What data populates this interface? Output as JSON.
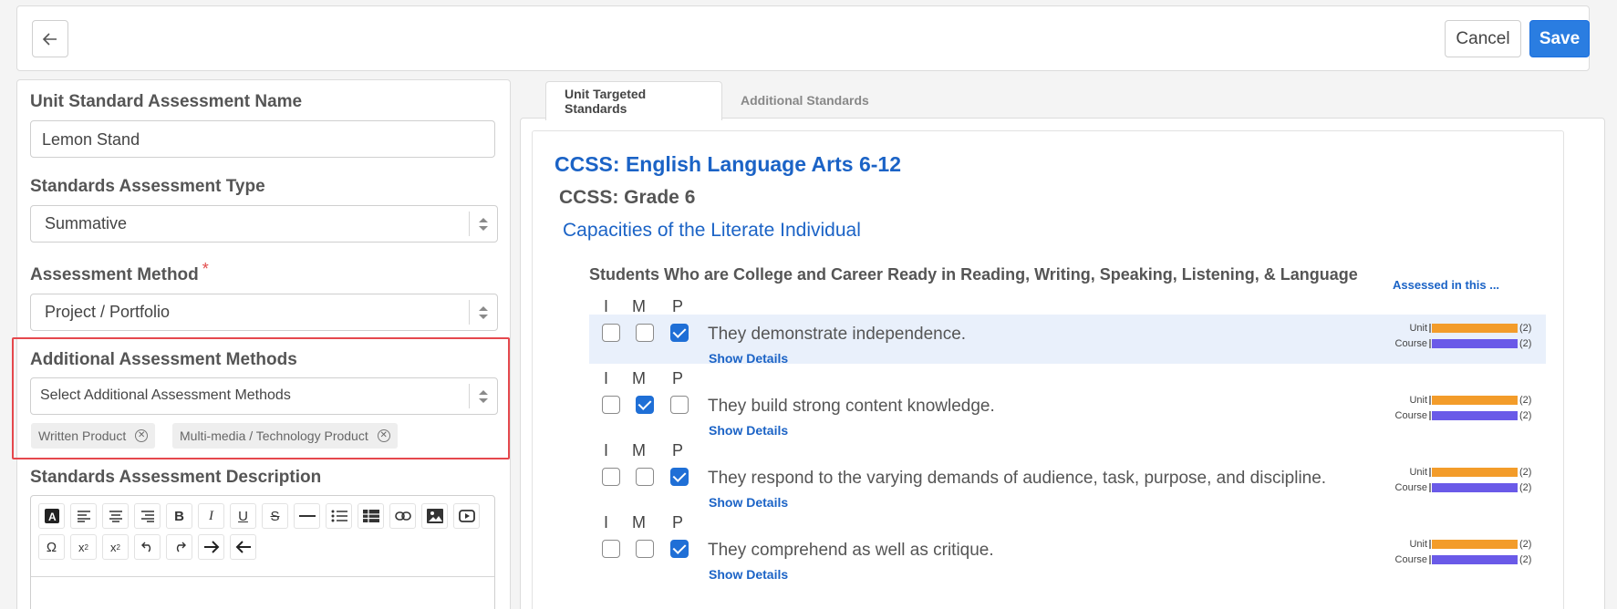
{
  "topbar": {
    "cancel_label": "Cancel",
    "save_label": "Save"
  },
  "form": {
    "name_label": "Unit Standard Assessment Name",
    "name_value": "Lemon Stand",
    "type_label": "Standards Assessment Type",
    "type_value": "Summative",
    "method_label": "Assessment Method",
    "method_required": "*",
    "method_value": "Project / Portfolio",
    "additional_label": "Additional Assessment Methods",
    "additional_placeholder": "Select Additional Assessment Methods",
    "chips": [
      "Written Product",
      "Multi-media / Technology Product"
    ],
    "description_label": "Standards Assessment Description",
    "toolbar_row1": [
      "text-color-icon",
      "align-left-icon",
      "align-center-icon",
      "align-right-icon",
      "bold-icon",
      "italic-icon",
      "underline-icon",
      "strikethrough-icon",
      "horizontal-rule-icon",
      "bullet-list-icon",
      "table-icon",
      "link-icon",
      "image-icon",
      "video-icon"
    ],
    "toolbar_row2": [
      "special-char-icon",
      "subscript-icon",
      "superscript-icon",
      "undo-icon",
      "redo-icon",
      "indent-icon",
      "outdent-icon"
    ]
  },
  "tabs": {
    "active": "Unit Targeted Standards",
    "inactive": "Additional Standards"
  },
  "standards": {
    "framework": "CCSS: English Language Arts 6-12",
    "grade": "CCSS: Grade 6",
    "category": "Capacities of the Literate Individual",
    "group": "Students Who are College and Career Ready in Reading, Writing, Speaking, Listening, & Language",
    "assessed_label": "Assessed in this ...",
    "imp_labels": [
      "I",
      "M",
      "P"
    ],
    "show_details": "Show Details",
    "bar_labels": [
      "Unit",
      "Course"
    ],
    "colors": {
      "unit": "#f39c2a",
      "course": "#6a5ae8",
      "accent": "#1b63c6"
    },
    "items": [
      {
        "text": "They demonstrate independence.",
        "checked": [
          false,
          false,
          true
        ],
        "unit": "(2)",
        "course": "(2)"
      },
      {
        "text": "They build strong content knowledge.",
        "checked": [
          false,
          true,
          false
        ],
        "unit": "(2)",
        "course": "(2)"
      },
      {
        "text": "They respond to the varying demands of audience, task, purpose, and discipline.",
        "checked": [
          false,
          false,
          true
        ],
        "unit": "(2)",
        "course": "(2)"
      },
      {
        "text": "They comprehend as well as critique.",
        "checked": [
          false,
          false,
          true
        ],
        "unit": "(2)",
        "course": "(2)"
      }
    ]
  }
}
